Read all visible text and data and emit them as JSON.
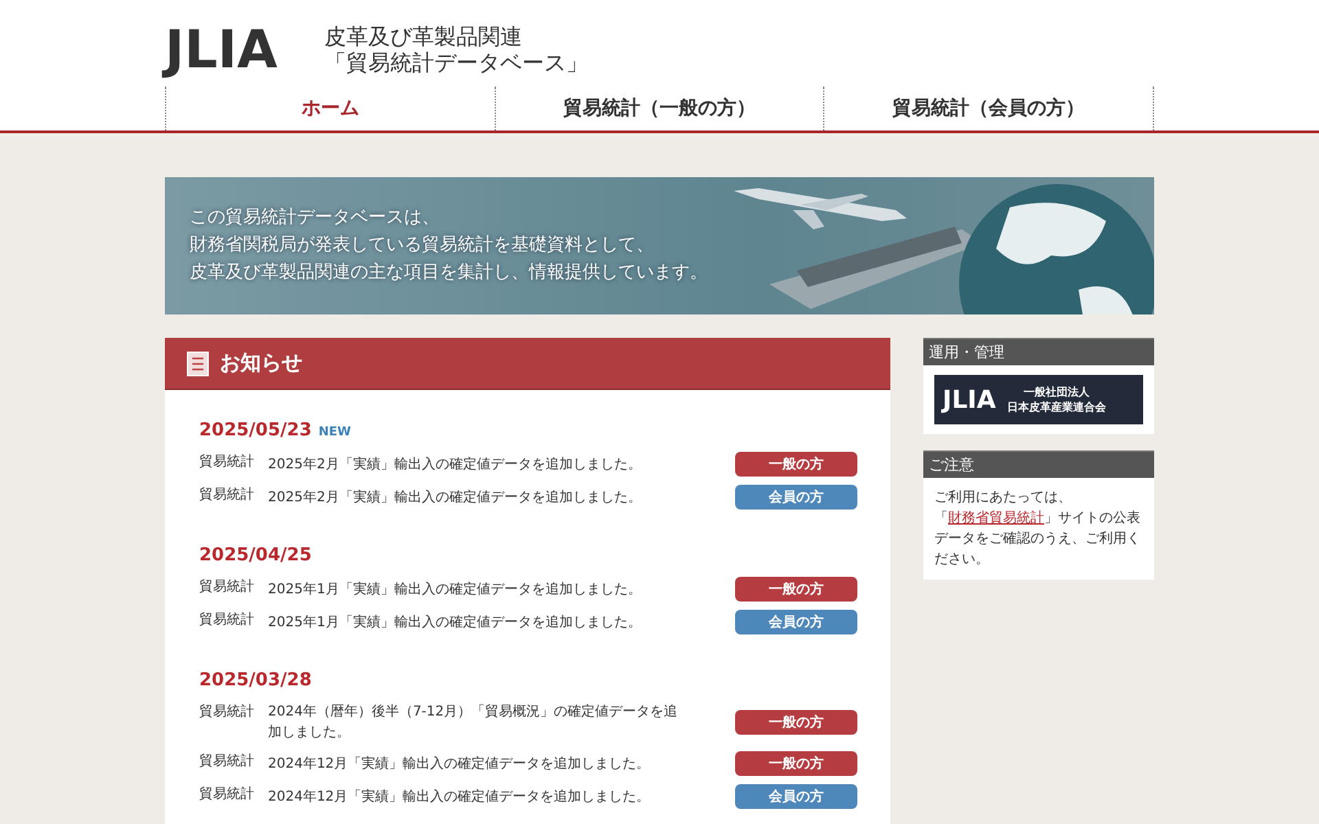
{
  "header": {
    "logo": {
      "mark": "JLIA"
    },
    "site_title": [
      "皮革及び革製品関連",
      "「貿易統計データベース」"
    ]
  },
  "nav": [
    {
      "label": "ホーム",
      "selected": true
    },
    {
      "label": "貿易統計（一般の方）",
      "selected": false
    },
    {
      "label": "貿易統計（会員の方）",
      "selected": false
    }
  ],
  "banner": {
    "lines": [
      "この貿易統計データベースは、",
      "財務省関税局が発表している貿易統計を基礎資料として、",
      "皮革及び革製品関連の主な項目を集計し、情報提供しています。"
    ]
  },
  "news": {
    "title": "お知らせ",
    "groups": [
      {
        "date": "2025/05/23",
        "badge": "NEW",
        "items": [
          {
            "category": "貿易統計",
            "text": "2025年2月「実績」輸出入の確定値データを追加しました。",
            "button": "一般の方",
            "kind": "general"
          },
          {
            "category": "貿易統計",
            "text": "2025年2月「実績」輸出入の確定値データを追加しました。",
            "button": "会員の方",
            "kind": "member"
          }
        ]
      },
      {
        "date": "2025/04/25",
        "items": [
          {
            "category": "貿易統計",
            "text": "2025年1月「実績」輸出入の確定値データを追加しました。",
            "button": "一般の方",
            "kind": "general"
          },
          {
            "category": "貿易統計",
            "text": "2025年1月「実績」輸出入の確定値データを追加しました。",
            "button": "会員の方",
            "kind": "member"
          }
        ]
      },
      {
        "date": "2025/03/28",
        "items": [
          {
            "category": "貿易統計",
            "text": "2024年（暦年）後半（7-12月）「貿易概況」の確定値データを追加しました。",
            "button": "一般の方",
            "kind": "general"
          },
          {
            "category": "貿易統計",
            "text": "2024年12月「実績」輸出入の確定値データを追加しました。",
            "button": "一般の方",
            "kind": "general"
          },
          {
            "category": "貿易統計",
            "text": "2024年12月「実績」輸出入の確定値データを追加しました。",
            "button": "会員の方",
            "kind": "member"
          }
        ]
      }
    ]
  },
  "sidebar": {
    "operation": {
      "title": "運用・管理",
      "logo_mark": "JLIA",
      "org_lines": [
        "一般社団法人",
        "日本皮革産業連合会"
      ]
    },
    "notice": {
      "title": "ご注意",
      "before": "ご利用にあたっては、「",
      "link": "財務省貿易統計",
      "after": "」サイトの公表データをご確認のうえ、ご利用ください。"
    }
  }
}
